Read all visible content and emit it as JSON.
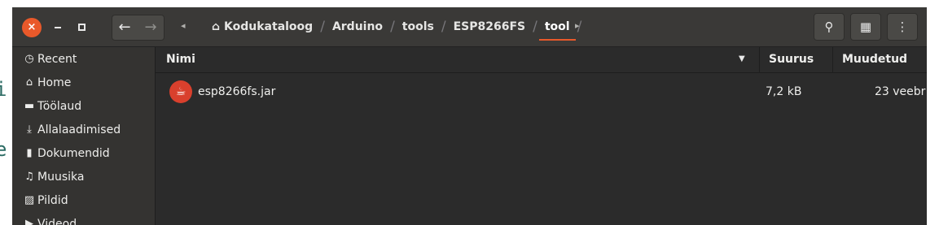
{
  "background": {
    "fragments": [
      "i",
      "e"
    ]
  },
  "window": {
    "close_glyph": "×",
    "nav": {
      "back_glyph": "←",
      "forward_glyph": "→"
    },
    "breadcrumb": {
      "left_arrow": "◂",
      "right_arrow": "▸",
      "home_glyph": "⌂",
      "separator": "/",
      "items": [
        "Kodukataloog",
        "Arduino",
        "tools",
        "ESP8266FS",
        "tool"
      ]
    },
    "actions": {
      "search_glyph": "⚲",
      "view_glyph": "▦",
      "menu_glyph": "⋮"
    }
  },
  "sidebar": {
    "items": [
      {
        "label": "Recent",
        "icon": "clock-icon",
        "glyph": "◷"
      },
      {
        "label": "Home",
        "icon": "home-icon",
        "glyph": "⌂"
      },
      {
        "label": "Töölaud",
        "icon": "desktop-icon",
        "glyph": "▬"
      },
      {
        "label": "Allalaadimised",
        "icon": "download-icon",
        "glyph": "⤓"
      },
      {
        "label": "Dokumendid",
        "icon": "document-icon",
        "glyph": "▮"
      },
      {
        "label": "Muusika",
        "icon": "music-icon",
        "glyph": "♫"
      },
      {
        "label": "Pildid",
        "icon": "picture-icon",
        "glyph": "▨"
      },
      {
        "label": "Videod",
        "icon": "video-icon",
        "glyph": "▶"
      }
    ]
  },
  "files": {
    "columns": {
      "name": "Nimi",
      "size": "Suurus",
      "modified": "Muudetud",
      "sort_glyph": "▼"
    },
    "rows": [
      {
        "name": "esp8266fs.jar",
        "size": "7,2 kB",
        "modified": "23 veebr",
        "icon": "java-icon",
        "icon_glyph": "☕"
      }
    ]
  },
  "colors": {
    "accent": "#e9592a",
    "headerbar": "#3a3937",
    "sidebar": "#343331",
    "content": "#2b2b2b",
    "java_icon": "#d9402d"
  }
}
